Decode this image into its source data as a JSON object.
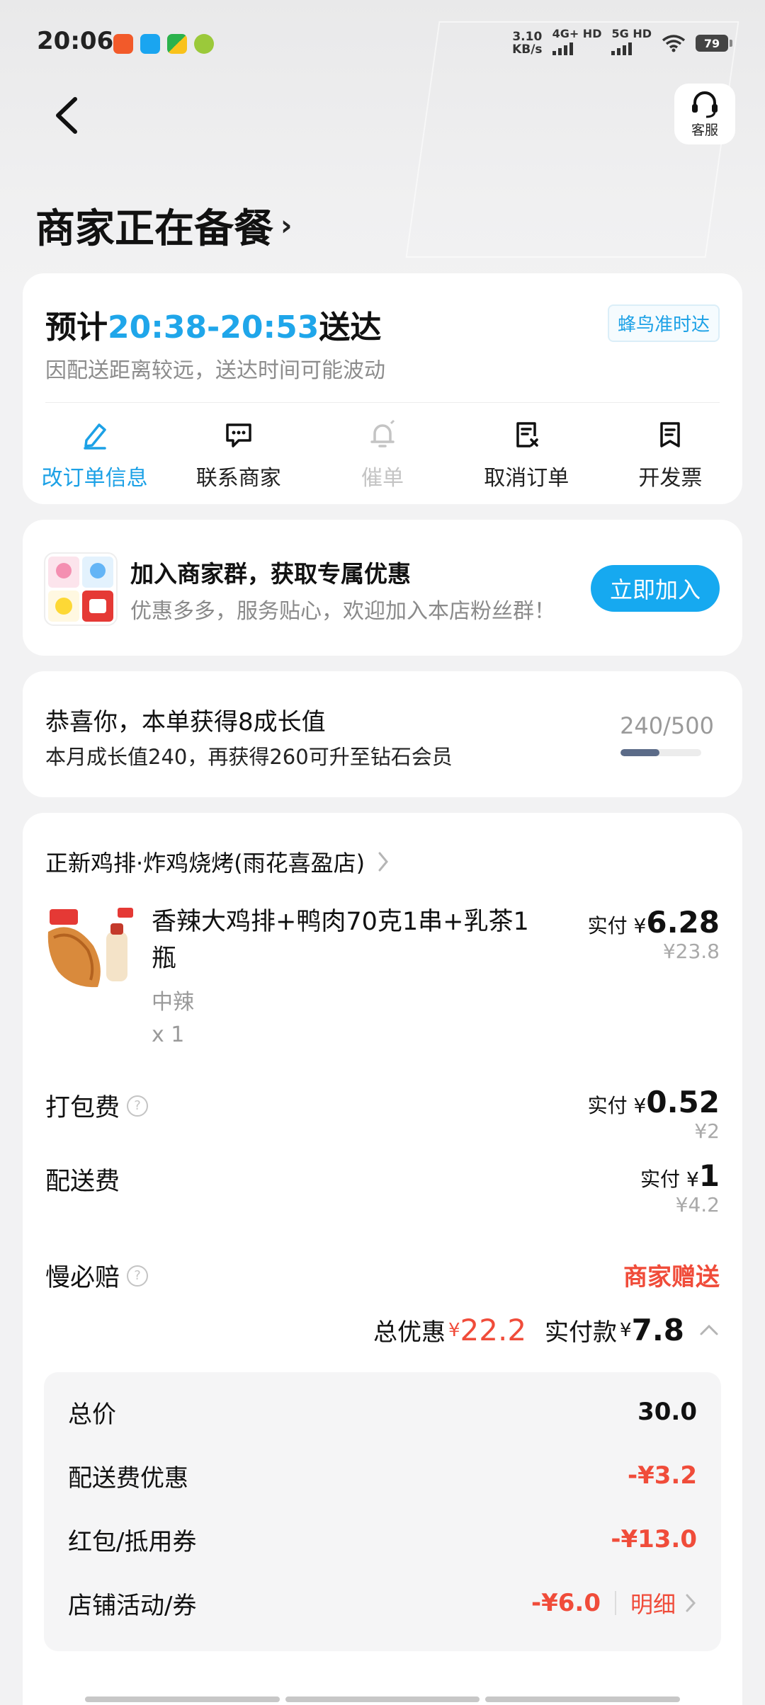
{
  "status_bar": {
    "time": "20:06",
    "net_speed_value": "3.10",
    "net_speed_unit": "KB/s",
    "sim1": "4G+ HD",
    "sim2": "5G HD",
    "battery": "79"
  },
  "header": {
    "service_label": "客服",
    "title": "商家正在备餐",
    "title_chevron": "›"
  },
  "delivery": {
    "eta_prefix": "预计",
    "eta_time": "20:38-20:53",
    "eta_suffix": "送达",
    "badge": "蜂鸟准时达",
    "note": "因配送距离较远，送达时间可能波动",
    "actions": [
      {
        "label": "改订单信息",
        "icon": "edit-icon"
      },
      {
        "label": "联系商家",
        "icon": "chat-icon"
      },
      {
        "label": "催单",
        "icon": "bell-icon"
      },
      {
        "label": "取消订单",
        "icon": "cancel-doc-icon"
      },
      {
        "label": "开发票",
        "icon": "invoice-icon"
      }
    ]
  },
  "group": {
    "title": "加入商家群，获取专属优惠",
    "subtitle": "优惠多多，服务贴心，欢迎加入本店粉丝群！",
    "button": "立即加入"
  },
  "growth": {
    "title": "恭喜你，本单获得8成长值",
    "subtitle": "本月成长值240，再获得260可升至钻石会员",
    "progress_text": "240/500",
    "progress_value": 0.48
  },
  "order": {
    "store_name": "正新鸡排·炸鸡烧烤(雨花喜盈店)",
    "item": {
      "name": "香辣大鸡排+鸭肉70克1串+乳茶1瓶",
      "spec": "中辣",
      "qty": "x 1",
      "pay_label": "实付",
      "yen": "¥",
      "pay_value": "6.28",
      "orig": "¥23.8"
    },
    "packing": {
      "label": "打包费",
      "pay_label": "实付",
      "yen": "¥",
      "pay_value": "0.52",
      "orig": "¥2"
    },
    "delivery_fee": {
      "label": "配送费",
      "pay_label": "实付",
      "yen": "¥",
      "pay_value": "1",
      "orig": "¥4.2"
    },
    "slow_comp": {
      "label": "慢必赔",
      "value": "商家赠送"
    },
    "summary": {
      "discount_label": "总优惠",
      "yen": "¥",
      "discount_value": "22.2",
      "paid_label": "实付款",
      "paid_value": "7.8"
    },
    "breakdown": [
      {
        "label": "总价",
        "value": "30.0"
      },
      {
        "label": "配送费优惠",
        "value": "-¥3.2"
      },
      {
        "label": "红包/抵用券",
        "value": "-¥13.0"
      },
      {
        "label": "店铺活动/券",
        "value": "-¥6.0",
        "link": "明细"
      }
    ]
  },
  "colors": {
    "accent_blue": "#1fa6ea",
    "price_red": "#f04c3a",
    "background": "#f2f2f3"
  }
}
